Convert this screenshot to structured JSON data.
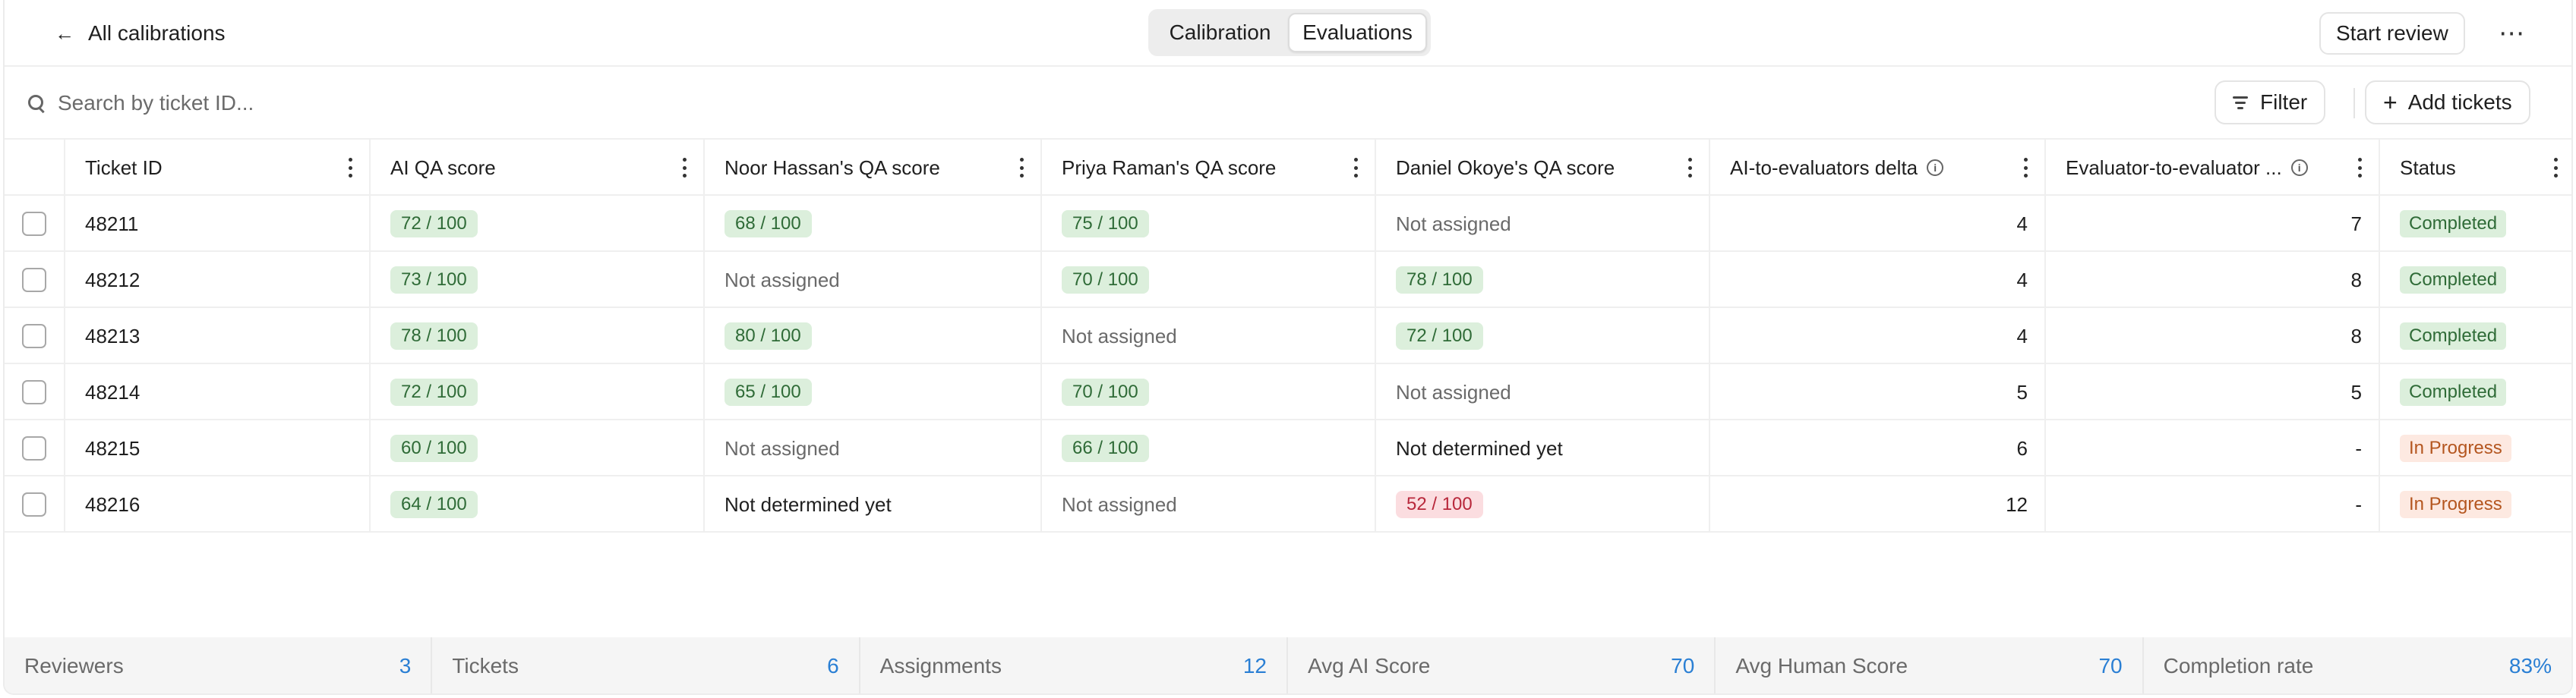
{
  "header": {
    "back_label": "All calibrations",
    "segments": [
      "Calibration",
      "Evaluations"
    ],
    "active_segment": "Evaluations",
    "start_review": "Start review",
    "more": "⋯"
  },
  "toolbar": {
    "search_placeholder": "Search by ticket ID...",
    "filter": "Filter",
    "add_tickets": "Add tickets"
  },
  "table": {
    "columns": [
      "Ticket ID",
      "AI QA score",
      "Noor Hassan's QA score",
      "Priya Raman's QA score",
      "Daniel Okoye's QA score",
      "AI-to-evaluators delta",
      "Evaluator-to-evaluator ...",
      "Status"
    ],
    "rows": [
      {
        "id": "48211",
        "ai": "72 / 100",
        "noor": "68 / 100",
        "priya": "75 / 100",
        "daniel": "Not assigned",
        "ai_delta": "4",
        "eval_delta": "7",
        "status": "Completed"
      },
      {
        "id": "48212",
        "ai": "73 / 100",
        "noor": "Not assigned",
        "priya": "70 / 100",
        "daniel": "78 / 100",
        "ai_delta": "4",
        "eval_delta": "8",
        "status": "Completed"
      },
      {
        "id": "48213",
        "ai": "78 / 100",
        "noor": "80 / 100",
        "priya": "Not assigned",
        "daniel": "72 / 100",
        "ai_delta": "4",
        "eval_delta": "8",
        "status": "Completed"
      },
      {
        "id": "48214",
        "ai": "72 / 100",
        "noor": "65 / 100",
        "priya": "70 / 100",
        "daniel": "Not assigned",
        "ai_delta": "5",
        "eval_delta": "5",
        "status": "Completed"
      },
      {
        "id": "48215",
        "ai": "60 / 100",
        "noor": "Not assigned",
        "priya": "66 / 100",
        "daniel": "Not determined yet",
        "ai_delta": "6",
        "eval_delta": "-",
        "status": "In Progress"
      },
      {
        "id": "48216",
        "ai": "64 / 100",
        "noor": "Not determined yet",
        "priya": "Not assigned",
        "daniel": "52 / 100",
        "ai_delta": "12",
        "eval_delta": "-",
        "status": "In Progress"
      }
    ]
  },
  "footer": [
    {
      "label": "Reviewers",
      "value": "3"
    },
    {
      "label": "Tickets",
      "value": "6"
    },
    {
      "label": "Assignments",
      "value": "12"
    },
    {
      "label": "Avg AI Score",
      "value": "70"
    },
    {
      "label": "Avg Human Score",
      "value": "70"
    },
    {
      "label": "Completion rate",
      "value": "83%"
    }
  ],
  "colors": {
    "accent": "#2a7fd4",
    "pill_green_bg": "#dcefdc",
    "pill_green_fg": "#2f6b37",
    "pill_red_bg": "#fbdde0",
    "pill_red_fg": "#b8283b",
    "status_progress_bg": "#fde9e1",
    "status_progress_fg": "#b4561f"
  }
}
